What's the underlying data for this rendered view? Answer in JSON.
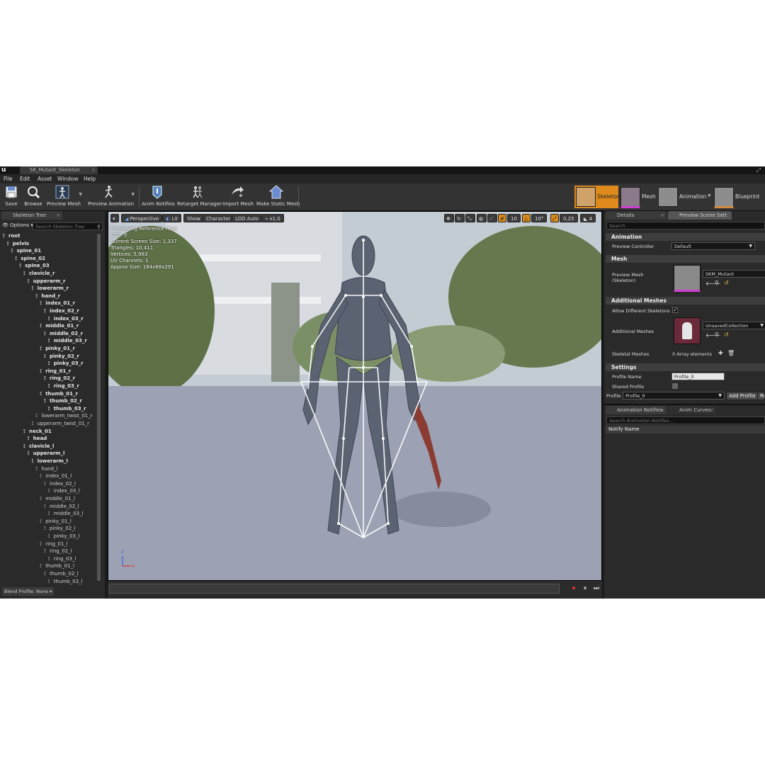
{
  "window": {
    "asset_tab": "SK_Mutant_Skeleton",
    "logo": "u"
  },
  "menu": [
    "File",
    "Edit",
    "Asset",
    "Window",
    "Help"
  ],
  "toolbar": {
    "tools": [
      {
        "label": "Save",
        "icon": "save-icon"
      },
      {
        "label": "Browse",
        "icon": "browse-icon"
      },
      {
        "label": "Preview Mesh",
        "icon": "preview-mesh-icon"
      },
      {
        "label": "Preview Animation",
        "icon": "preview-animation-icon"
      },
      {
        "label": "Anim Notifies",
        "icon": "anim-notifies-icon"
      },
      {
        "label": "Retarget Manager",
        "icon": "retarget-manager-icon"
      },
      {
        "label": "Import Mesh",
        "icon": "import-mesh-icon"
      },
      {
        "label": "Make Static Mesh",
        "icon": "make-static-mesh-icon"
      }
    ],
    "modes": [
      {
        "label": "Skeleton",
        "active": true
      },
      {
        "label": "Mesh",
        "active": false
      },
      {
        "label": "Animation",
        "active": false
      },
      {
        "label": "Blueprint",
        "active": false
      }
    ]
  },
  "skeleton_tree": {
    "tab": "Skeleton Tree",
    "options": "Options",
    "search_placeholder": "Search Skeleton Tree",
    "bones": [
      {
        "name": "root",
        "depth": 0,
        "bold": true
      },
      {
        "name": "pelvis",
        "depth": 1,
        "bold": true
      },
      {
        "name": "spine_01",
        "depth": 2,
        "bold": true
      },
      {
        "name": "spine_02",
        "depth": 3,
        "bold": true
      },
      {
        "name": "spine_03",
        "depth": 4,
        "bold": true
      },
      {
        "name": "clavicle_r",
        "depth": 5,
        "bold": true
      },
      {
        "name": "upperarm_r",
        "depth": 6,
        "bold": true
      },
      {
        "name": "lowerarm_r",
        "depth": 7,
        "bold": true
      },
      {
        "name": "hand_r",
        "depth": 8,
        "bold": true
      },
      {
        "name": "index_01_r",
        "depth": 9,
        "bold": true
      },
      {
        "name": "index_02_r",
        "depth": 10,
        "bold": true
      },
      {
        "name": "index_03_r",
        "depth": 11,
        "bold": true
      },
      {
        "name": "middle_01_r",
        "depth": 9,
        "bold": true
      },
      {
        "name": "middle_02_r",
        "depth": 10,
        "bold": true
      },
      {
        "name": "middle_03_r",
        "depth": 11,
        "bold": true
      },
      {
        "name": "pinky_01_r",
        "depth": 9,
        "bold": true
      },
      {
        "name": "pinky_02_r",
        "depth": 10,
        "bold": true
      },
      {
        "name": "pinky_03_r",
        "depth": 11,
        "bold": true
      },
      {
        "name": "ring_01_r",
        "depth": 9,
        "bold": true
      },
      {
        "name": "ring_02_r",
        "depth": 10,
        "bold": true
      },
      {
        "name": "ring_03_r",
        "depth": 11,
        "bold": true
      },
      {
        "name": "thumb_01_r",
        "depth": 9,
        "bold": true
      },
      {
        "name": "thumb_02_r",
        "depth": 10,
        "bold": true
      },
      {
        "name": "thumb_03_r",
        "depth": 11,
        "bold": true
      },
      {
        "name": "lowerarm_twist_01_r",
        "depth": 8,
        "bold": false
      },
      {
        "name": "upperarm_twist_01_r",
        "depth": 7,
        "bold": false
      },
      {
        "name": "neck_01",
        "depth": 5,
        "bold": true
      },
      {
        "name": "head",
        "depth": 6,
        "bold": true
      },
      {
        "name": "clavicle_l",
        "depth": 5,
        "bold": true
      },
      {
        "name": "upperarm_l",
        "depth": 6,
        "bold": true
      },
      {
        "name": "lowerarm_l",
        "depth": 7,
        "bold": true
      },
      {
        "name": "hand_l",
        "depth": 8,
        "bold": false
      },
      {
        "name": "index_01_l",
        "depth": 9,
        "bold": false
      },
      {
        "name": "index_02_l",
        "depth": 10,
        "bold": false
      },
      {
        "name": "index_03_l",
        "depth": 11,
        "bold": false
      },
      {
        "name": "middle_01_l",
        "depth": 9,
        "bold": false
      },
      {
        "name": "middle_02_l",
        "depth": 10,
        "bold": false
      },
      {
        "name": "middle_03_l",
        "depth": 11,
        "bold": false
      },
      {
        "name": "pinky_01_l",
        "depth": 9,
        "bold": false
      },
      {
        "name": "pinky_02_l",
        "depth": 10,
        "bold": false
      },
      {
        "name": "pinky_03_l",
        "depth": 11,
        "bold": false
      },
      {
        "name": "ring_01_l",
        "depth": 9,
        "bold": false
      },
      {
        "name": "ring_02_l",
        "depth": 10,
        "bold": false
      },
      {
        "name": "ring_03_l",
        "depth": 11,
        "bold": false
      },
      {
        "name": "thumb_01_l",
        "depth": 9,
        "bold": false
      },
      {
        "name": "thumb_02_l",
        "depth": 10,
        "bold": false
      },
      {
        "name": "thumb_03_l",
        "depth": 11,
        "bold": false
      }
    ],
    "footer": "Blend Profile: None"
  },
  "viewport": {
    "perspective": "Perspective",
    "lit": "Lit",
    "show": "Show",
    "character": "Character",
    "lod": "LOD Auto",
    "speed": "x1,0",
    "grid_snap": "10",
    "rot_snap": "10°",
    "scale_snap": "0,25",
    "cam_speed": "4",
    "info": [
      "Previewing Reference Pose",
      "LOD: 0",
      "Current Screen Size: 1,337",
      "Triangles: 10,411",
      "Vertices: 5,983",
      "UV Channels: 1",
      "Approx Size: 184x88x291"
    ],
    "axis_z": "z",
    "axis_x": "x"
  },
  "details": {
    "tab_details": "Details",
    "tab_preview": "Preview Scene Sett",
    "search_placeholder": "Search",
    "animation_section": "Animation",
    "preview_controller_label": "Preview Controller",
    "preview_controller_value": "Default",
    "mesh_section": "Mesh",
    "preview_mesh_label": "Preview Mesh (Skeleton)",
    "preview_mesh_value": "SKM_Mutant",
    "additional_section": "Additional Meshes",
    "allow_diff_label": "Allow Different Skeletons",
    "additional_meshes_label": "Additional Meshes",
    "additional_meshes_value": "UnsavedCollection",
    "skeletal_meshes_label": "Skeletal Meshes",
    "skeletal_meshes_value": "0 Array elements",
    "settings_section": "Settings",
    "profile_name_label": "Profile Name",
    "profile_name_value": "Profile_0",
    "shared_profile_label": "Shared Profile",
    "profile_label": "Profile",
    "profile_value": "Profile_0",
    "add_profile": "Add Profile",
    "remove_profile": "Re"
  },
  "notifies": {
    "tab_notifies": "Animation Notifies",
    "tab_curves": "Anim Curves",
    "search_placeholder": "Search Animation Notifies...",
    "header": "Notify Name"
  },
  "colors": {
    "accent": "#e08a1e",
    "panel": "#2a2a2a",
    "background": "#1b1b1b"
  }
}
